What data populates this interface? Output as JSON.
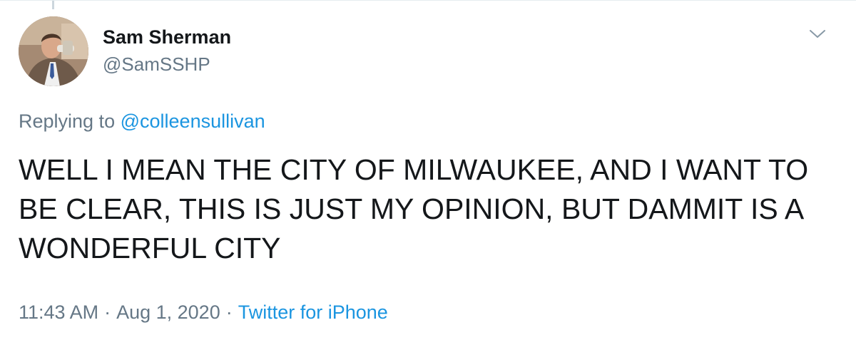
{
  "tweet": {
    "author": {
      "display_name": "Sam Sherman",
      "handle": "@SamSSHP",
      "avatar_icon": "user-avatar"
    },
    "more_menu_icon": "chevron-down-icon",
    "reply_context": {
      "prefix": "Replying to",
      "mention": "@colleensullivan"
    },
    "text": "WELL I MEAN THE CITY OF MILWAUKEE, AND I WANT TO BE CLEAR, THIS IS JUST MY OPINION, BUT DAMMIT IS A WONDERFUL CITY",
    "timestamp": {
      "time": "11:43 AM",
      "separator": "·",
      "date": "Aug 1, 2020",
      "source": "Twitter for iPhone"
    }
  },
  "colors": {
    "text_primary": "#14171a",
    "text_secondary": "#657786",
    "link": "#1b95e0",
    "divider": "#e6ecf0"
  }
}
